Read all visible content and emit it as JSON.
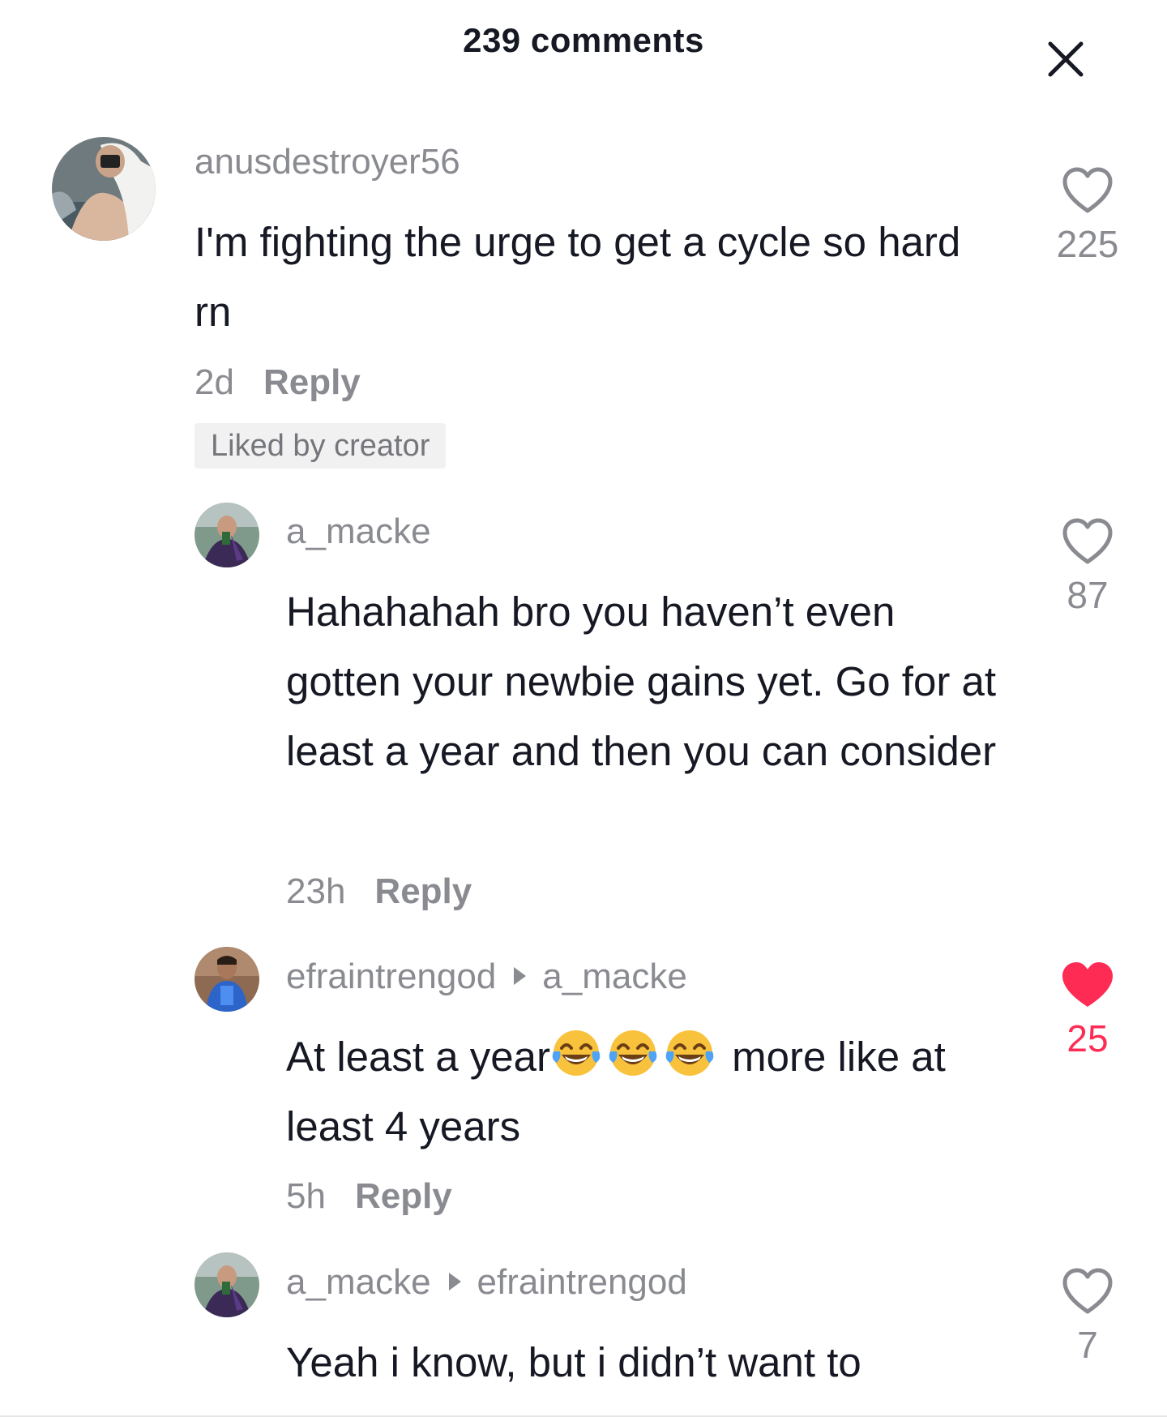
{
  "header": {
    "title": "239 comments",
    "close_icon": "close-icon"
  },
  "comments": [
    {
      "username": "anusdestroyer56",
      "text": "I'm fighting the urge to get a cycle so hard rn",
      "time": "2d",
      "reply_label": "Reply",
      "badge": "Liked by creator",
      "likes": "225",
      "liked": false
    },
    {
      "username": "a_macke",
      "text": "Hahahahah bro you haven’t even gotten your newbie gains yet. Go for at least a year and then you can consider",
      "time": "23h",
      "reply_label": "Reply",
      "likes": "87",
      "liked": false
    },
    {
      "username": "efraintrengod",
      "reply_to": "a_macke",
      "text_before_emoji": "At least a year",
      "emoji": "face-with-tears-of-joy",
      "emoji_count": 3,
      "text_after_emoji": " more like at least 4 years",
      "time": "5h",
      "reply_label": "Reply",
      "likes": "25",
      "liked": true
    },
    {
      "username": "a_macke",
      "reply_to": "efraintrengod",
      "text": "Yeah i know, but i didn’t want to",
      "likes": "7",
      "liked": false
    }
  ],
  "colors": {
    "primary_text": "#161823",
    "secondary_text": "#8a8b91",
    "like_active": "#fe2c55",
    "badge_bg": "#f1f1f2"
  }
}
